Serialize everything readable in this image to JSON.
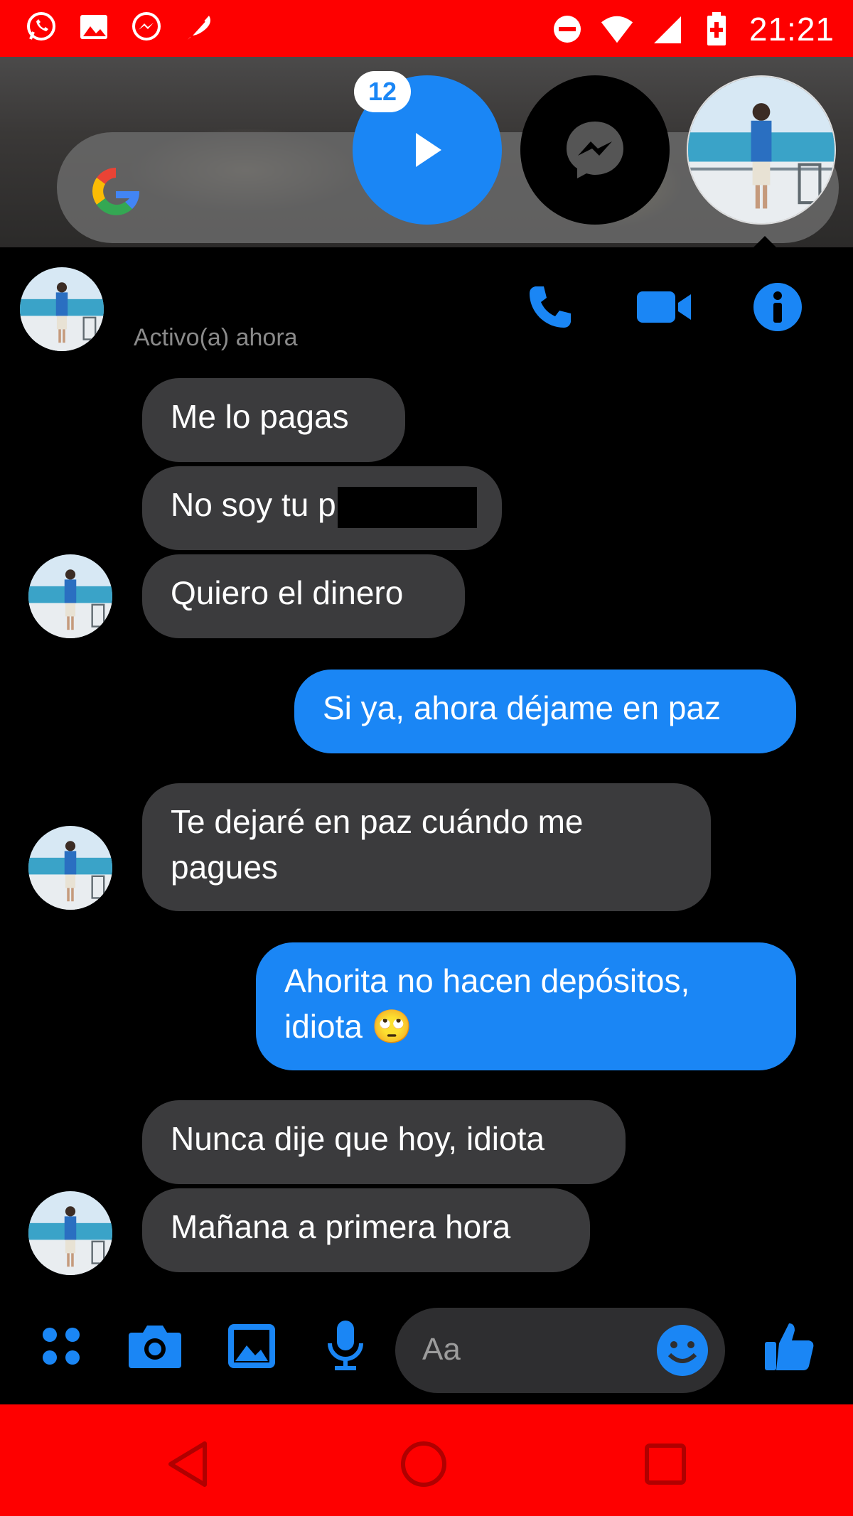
{
  "status_bar": {
    "time": "21:21",
    "left_icons": [
      "whatsapp-icon",
      "gallery-icon",
      "messenger-icon",
      "feather-icon"
    ],
    "right_icons": [
      "do-not-disturb-icon",
      "wifi-icon",
      "cellular-signal-icon",
      "battery-charging-icon"
    ]
  },
  "chat_heads": {
    "badge_count": "12"
  },
  "conversation_header": {
    "status": "Activo(a) ahora"
  },
  "messages": [
    {
      "side": "in",
      "text": "Me lo pagas"
    },
    {
      "side": "in",
      "text": "No soy tu p",
      "redacted": true
    },
    {
      "side": "in",
      "text": "Quiero el dinero"
    },
    {
      "side": "out",
      "text": "Si ya, ahora déjame en paz"
    },
    {
      "side": "in",
      "line1": "Te dejaré en paz cuándo me",
      "line2": "pagues"
    },
    {
      "side": "out",
      "line1": "Ahorita no hacen depósitos,",
      "line2": "idiota",
      "emoji": "🙄"
    },
    {
      "side": "in",
      "text": "Nunca dije que hoy, idiota"
    },
    {
      "side": "in",
      "text": "Mañana a primera hora"
    }
  ],
  "composer": {
    "placeholder": "Aa"
  },
  "colors": {
    "accent": "#1a86f5",
    "status_bar": "#fe0000",
    "incoming_bubble": "#3b3b3d",
    "background": "#000000"
  }
}
